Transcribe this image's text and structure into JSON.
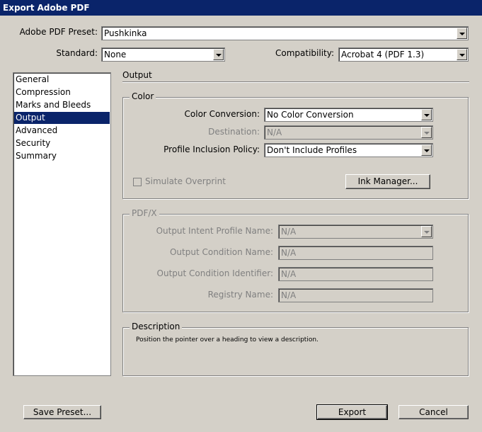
{
  "window": {
    "title": "Export Adobe PDF"
  },
  "preset": {
    "label": "Adobe PDF Preset:",
    "value": "Pushkinka"
  },
  "standard": {
    "label": "Standard:",
    "value": "None"
  },
  "compatibility": {
    "label": "Compatibility:",
    "value": "Acrobat 4 (PDF 1.3)"
  },
  "sidebar": {
    "items": [
      {
        "label": "General"
      },
      {
        "label": "Compression"
      },
      {
        "label": "Marks and Bleeds"
      },
      {
        "label": "Output"
      },
      {
        "label": "Advanced"
      },
      {
        "label": "Security"
      },
      {
        "label": "Summary"
      }
    ],
    "selected": "Output"
  },
  "panel": {
    "title": "Output"
  },
  "color": {
    "group_title": "Color",
    "conversion_label": "Color Conversion:",
    "conversion_value": "No Color Conversion",
    "destination_label": "Destination:",
    "destination_value": "N/A",
    "profile_label": "Profile Inclusion Policy:",
    "profile_value": "Don't Include Profiles",
    "simulate_label": "Simulate Overprint",
    "ink_manager_label": "Ink Manager..."
  },
  "pdfx": {
    "group_title": "PDF/X",
    "intent_label": "Output Intent Profile Name:",
    "intent_value": "N/A",
    "condition_name_label": "Output Condition Name:",
    "condition_name_value": "N/A",
    "condition_id_label": "Output Condition Identifier:",
    "condition_id_value": "N/A",
    "registry_label": "Registry Name:",
    "registry_value": "N/A"
  },
  "description": {
    "group_title": "Description",
    "text": "Position the pointer over a heading to view a description."
  },
  "buttons": {
    "save_preset": "Save Preset...",
    "export": "Export",
    "cancel": "Cancel"
  }
}
